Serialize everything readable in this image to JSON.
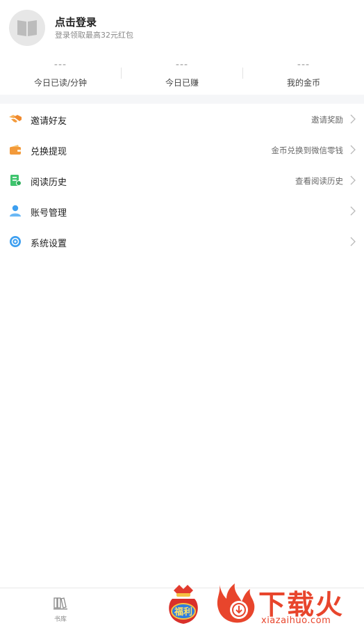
{
  "profile": {
    "title": "点击登录",
    "subtitle": "登录领取最高32元红包",
    "avatar_icon": "book-icon"
  },
  "stats": [
    {
      "value": "---",
      "label": "今日已读/分钟"
    },
    {
      "value": "---",
      "label": "今日已赚"
    },
    {
      "value": "---",
      "label": "我的金币"
    }
  ],
  "menu": [
    {
      "label": "邀请好友",
      "right": "邀请奖励",
      "icon": "handshake-icon",
      "color": "#f39a3a"
    },
    {
      "label": "兑换提现",
      "right": "金币兑换到微信零钱",
      "icon": "wallet-icon",
      "color": "#f08a2e"
    },
    {
      "label": "阅读历史",
      "right": "查看阅读历史",
      "icon": "history-book-icon",
      "color": "#3ec46d"
    },
    {
      "label": "账号管理",
      "right": "",
      "icon": "user-icon",
      "color": "#3d9ff0"
    },
    {
      "label": "系统设置",
      "right": "",
      "icon": "settings-icon",
      "color": "#3d9ff0"
    }
  ],
  "tabbar": {
    "library_label": "书库",
    "welfare_label": "福利"
  },
  "watermark": {
    "text": "下载火",
    "url": "xiazaihuo.com",
    "color": "#e8452c"
  }
}
